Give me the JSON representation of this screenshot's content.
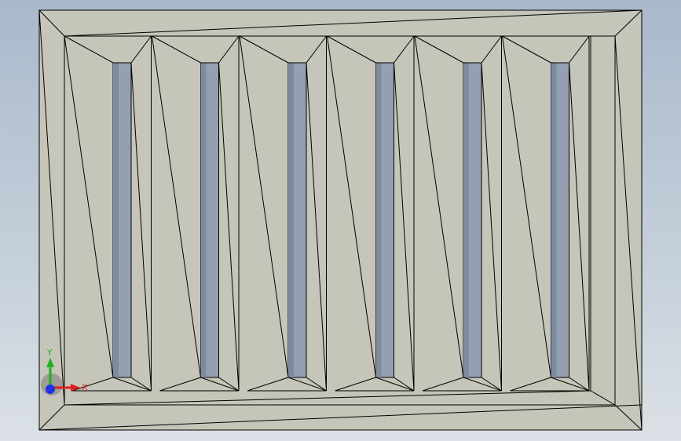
{
  "colors": {
    "background_top": "#a9b9cb",
    "background_bottom": "#dbe1e6",
    "face": "#c6c5b9",
    "edge": "#000000",
    "slot_fill": "#94a0b2",
    "axis_x": "#e02020",
    "axis_y": "#20b020",
    "axis_z": "#2030e0"
  },
  "part": {
    "type": "vent-grille",
    "slot_count": 6
  },
  "triad": {
    "x_label": "X",
    "y_label": "Y",
    "icon": "coordinate-triad-icon"
  }
}
